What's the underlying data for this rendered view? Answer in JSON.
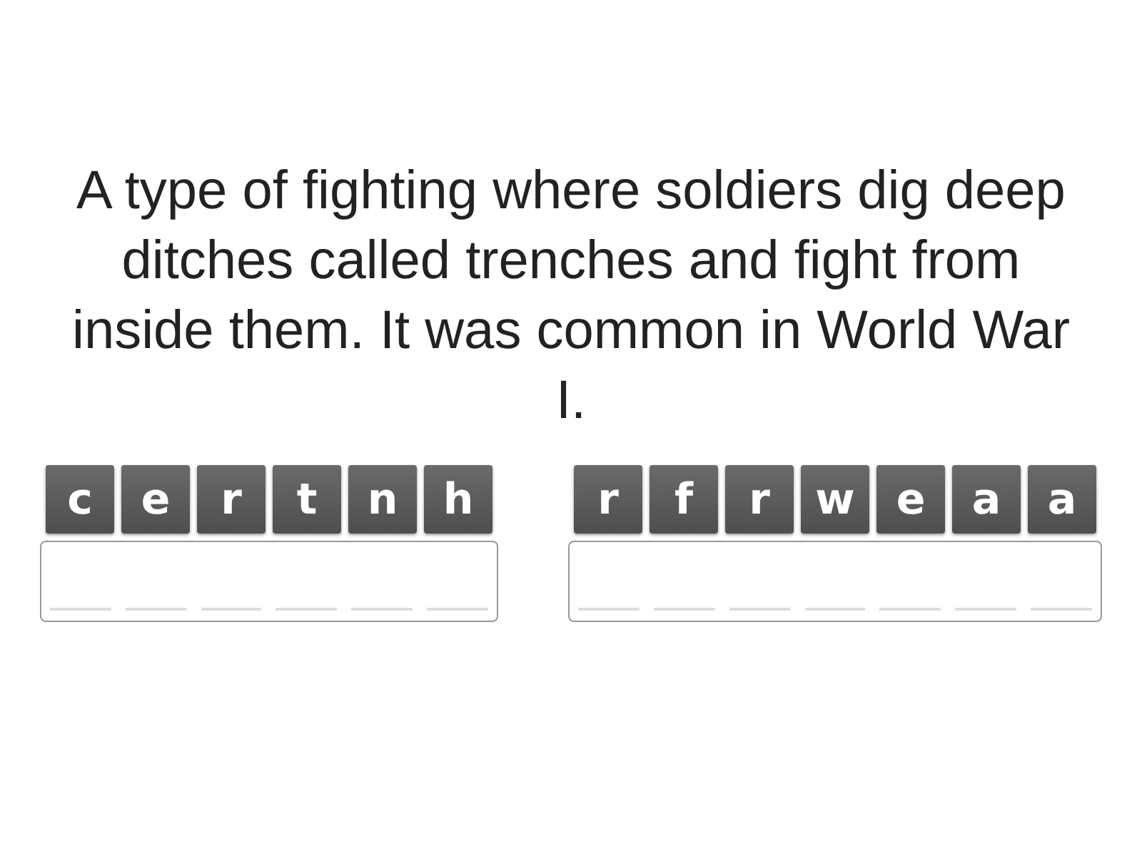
{
  "question": "A type of fighting where soldiers dig deep ditches called trenches and fight from inside them. It was common in World War I.",
  "words": [
    {
      "letters": [
        "c",
        "e",
        "r",
        "t",
        "n",
        "h"
      ]
    },
    {
      "letters": [
        "r",
        "f",
        "r",
        "w",
        "e",
        "a",
        "a"
      ]
    }
  ]
}
